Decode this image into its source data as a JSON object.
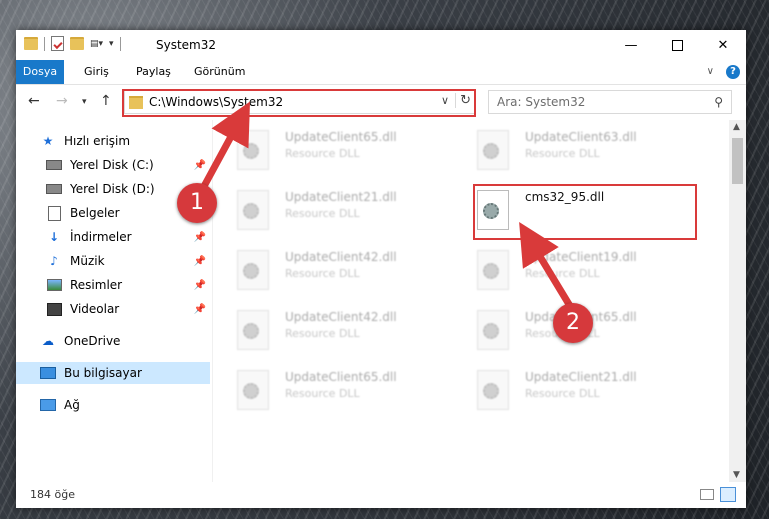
{
  "window": {
    "title": "System32",
    "minimize": "—",
    "close": "✕"
  },
  "ribbon": {
    "tabs": [
      "Dosya",
      "Giriş",
      "Paylaş",
      "Görünüm"
    ],
    "help": "?"
  },
  "nav": {
    "back": "←",
    "forward": "→",
    "recent": "▾",
    "up": "↑",
    "address": "C:\\Windows\\System32",
    "search_placeholder": "Ara: System32"
  },
  "sidebar": {
    "items": [
      {
        "label": "Hızlı erişim",
        "icon": "star-icon"
      },
      {
        "label": "Yerel Disk (C:)",
        "icon": "drive-icon",
        "pinned": true
      },
      {
        "label": "Yerel Disk (D:)",
        "icon": "drive-icon"
      },
      {
        "label": "Belgeler",
        "icon": "documents-icon"
      },
      {
        "label": "İndirmeler",
        "icon": "downloads-icon",
        "pinned": true
      },
      {
        "label": "Müzik",
        "icon": "music-icon",
        "pinned": true
      },
      {
        "label": "Resimler",
        "icon": "pictures-icon",
        "pinned": true
      },
      {
        "label": "Videolar",
        "icon": "videos-icon",
        "pinned": true
      },
      {
        "label": "OneDrive",
        "icon": "onedrive-icon"
      },
      {
        "label": "Bu bilgisayar",
        "icon": "computer-icon",
        "selected": true
      },
      {
        "label": "Ağ",
        "icon": "network-icon"
      }
    ]
  },
  "files": [
    {
      "name": "UpdateClient65.dll",
      "desc": "Resource DLL"
    },
    {
      "name": "UpdateClient63.dll",
      "desc": "Resource DLL"
    },
    {
      "name": "UpdateClient21.dll",
      "desc": "Resource DLL"
    },
    {
      "name": "cms32_95.dll",
      "desc": ""
    },
    {
      "name": "UpdateClient42.dll",
      "desc": "Resource DLL"
    },
    {
      "name": "UpdateClient19.dll",
      "desc": "Resource DLL"
    },
    {
      "name": "UpdateClient42.dll",
      "desc": "Resource DLL"
    },
    {
      "name": "UpdateClient65.dll",
      "desc": "Resource DLL"
    },
    {
      "name": "UpdateClient65.dll",
      "desc": "Resource DLL"
    },
    {
      "name": "UpdateClient21.dll",
      "desc": "Resource DLL"
    }
  ],
  "status": {
    "count": "184 öğe"
  },
  "annotations": {
    "step1": "1",
    "step2": "2",
    "color": "#d93a3a"
  }
}
